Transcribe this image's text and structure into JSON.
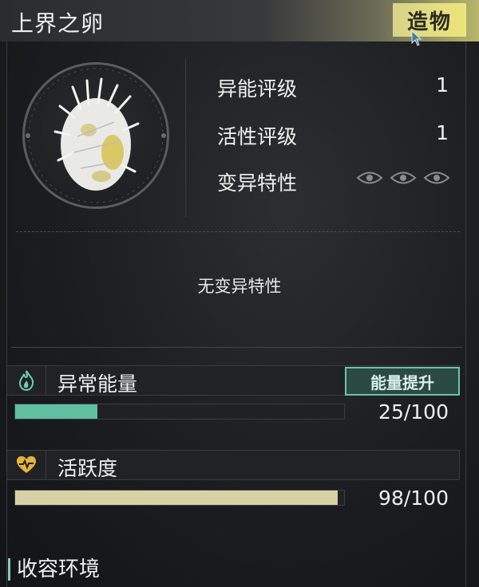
{
  "header": {
    "title": "上界之卵",
    "tag_button": "造物"
  },
  "stats": [
    {
      "label": "异能评级",
      "value": "1"
    },
    {
      "label": "活性评级",
      "value": "1"
    }
  ],
  "mutation": {
    "label": "变异特性",
    "slot_icons": [
      "eye-icon",
      "eye-icon",
      "eye-icon"
    ],
    "empty_text": "无变异特性"
  },
  "energy": {
    "label": "异常能量",
    "icon": "flame-icon",
    "button": "能量提升",
    "value_text": "25/100",
    "fraction": 0.25,
    "color": "#5fbf9e"
  },
  "activity": {
    "label": "活跃度",
    "icon": "heart-pulse-icon",
    "value_text": "98/100",
    "fraction": 0.98,
    "color": "#d6d2a6"
  },
  "section": {
    "title": "收容环境"
  }
}
